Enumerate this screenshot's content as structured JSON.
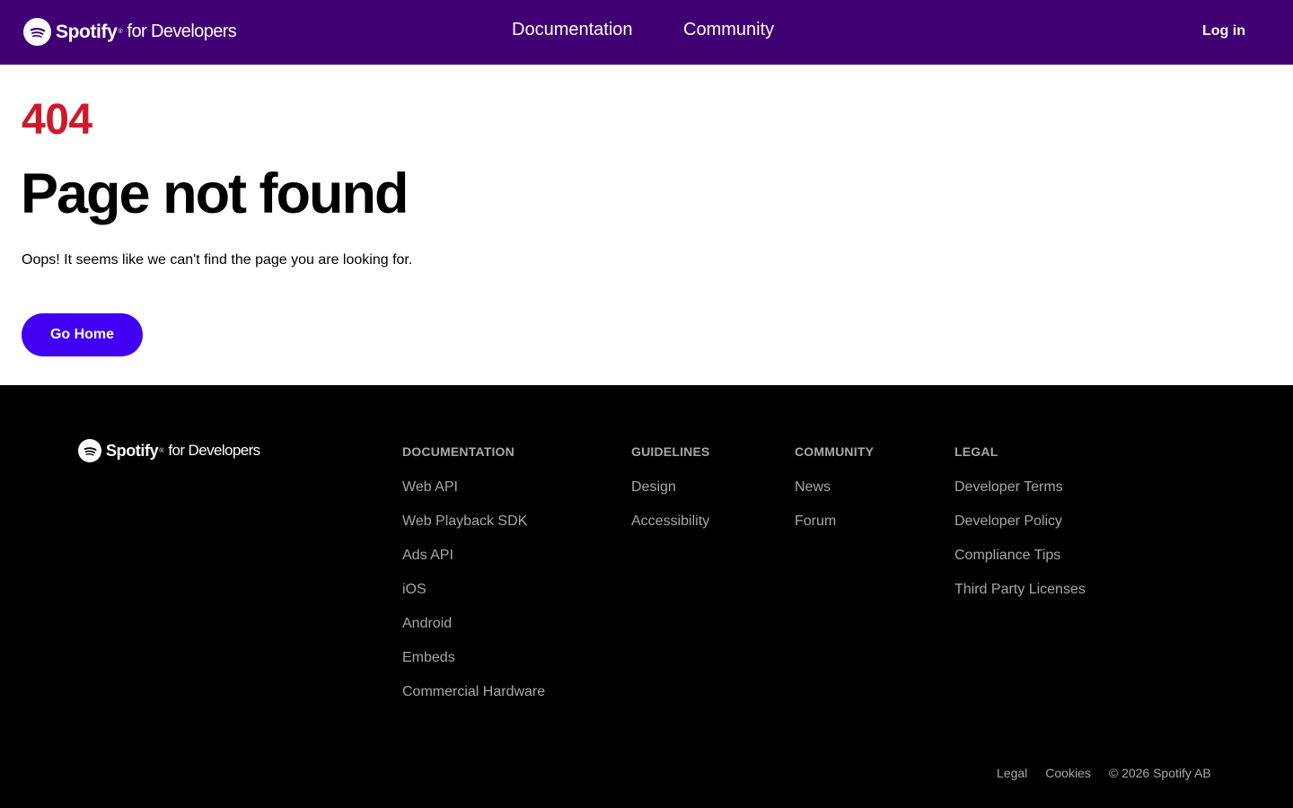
{
  "header": {
    "brand": {
      "name": "Spotify",
      "suffix": "for Developers",
      "icon": "spotify-logo-icon"
    },
    "nav": [
      {
        "label": "Documentation"
      },
      {
        "label": "Community"
      }
    ],
    "login_label": "Log in",
    "background_color": "#400073"
  },
  "main": {
    "error_code": "404",
    "title": "Page not found",
    "description": "Oops! It seems like we can't find the page you are looking for.",
    "button_label": "Go Home",
    "error_color": "#cd1a2b",
    "button_color": "#4100f4"
  },
  "footer": {
    "brand": {
      "name": "Spotify",
      "suffix": "for Developers",
      "icon": "spotify-logo-icon"
    },
    "columns": [
      {
        "heading": "DOCUMENTATION",
        "links": [
          "Web API",
          "Web Playback SDK",
          "Ads API",
          "iOS",
          "Android",
          "Embeds",
          "Commercial Hardware"
        ]
      },
      {
        "heading": "GUIDELINES",
        "links": [
          "Design",
          "Accessibility"
        ]
      },
      {
        "heading": "COMMUNITY",
        "links": [
          "News",
          "Forum"
        ]
      },
      {
        "heading": "LEGAL",
        "links": [
          "Developer Terms",
          "Developer Policy",
          "Compliance Tips",
          "Third Party Licenses"
        ]
      }
    ],
    "bottom": {
      "legal": "Legal",
      "cookies": "Cookies",
      "copyright": "© 2026 Spotify AB"
    }
  }
}
